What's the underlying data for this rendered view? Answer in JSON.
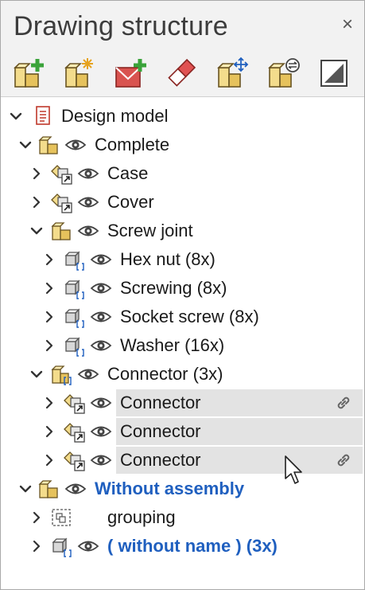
{
  "panel": {
    "title": "Drawing structure",
    "close_symbol": "×"
  },
  "toolbar": {
    "buttons": [
      {
        "name": "add-assembly",
        "icon": "add-assembly-icon"
      },
      {
        "name": "new-assembly",
        "icon": "new-assembly-icon"
      },
      {
        "name": "add-mail",
        "icon": "add-envelope-icon"
      },
      {
        "name": "eraser",
        "icon": "eraser-icon"
      },
      {
        "name": "move-assembly",
        "icon": "move-assembly-icon"
      },
      {
        "name": "assembly-settings",
        "icon": "assembly-settings-icon"
      },
      {
        "name": "toggle-view",
        "icon": "half-square-icon"
      }
    ]
  },
  "tree": {
    "design_model": "Design model",
    "complete": "Complete",
    "case": "Case",
    "cover": "Cover",
    "screw_joint": "Screw joint",
    "hex_nut": "Hex nut (8x)",
    "screwing": "Screwing (8x)",
    "socket_screw": "Socket screw (8x)",
    "washer": "Washer (16x)",
    "connector_group": "Connector (3x)",
    "connector_1": "Connector",
    "connector_2": "Connector",
    "connector_3": "Connector",
    "without_assembly": "Without assembly",
    "grouping": "grouping",
    "without_name": "( without name ) (3x)"
  },
  "colors": {
    "accent_blue": "#1f5fbf",
    "selection": "#e3e3e3",
    "add_green": "#3aa33a"
  }
}
